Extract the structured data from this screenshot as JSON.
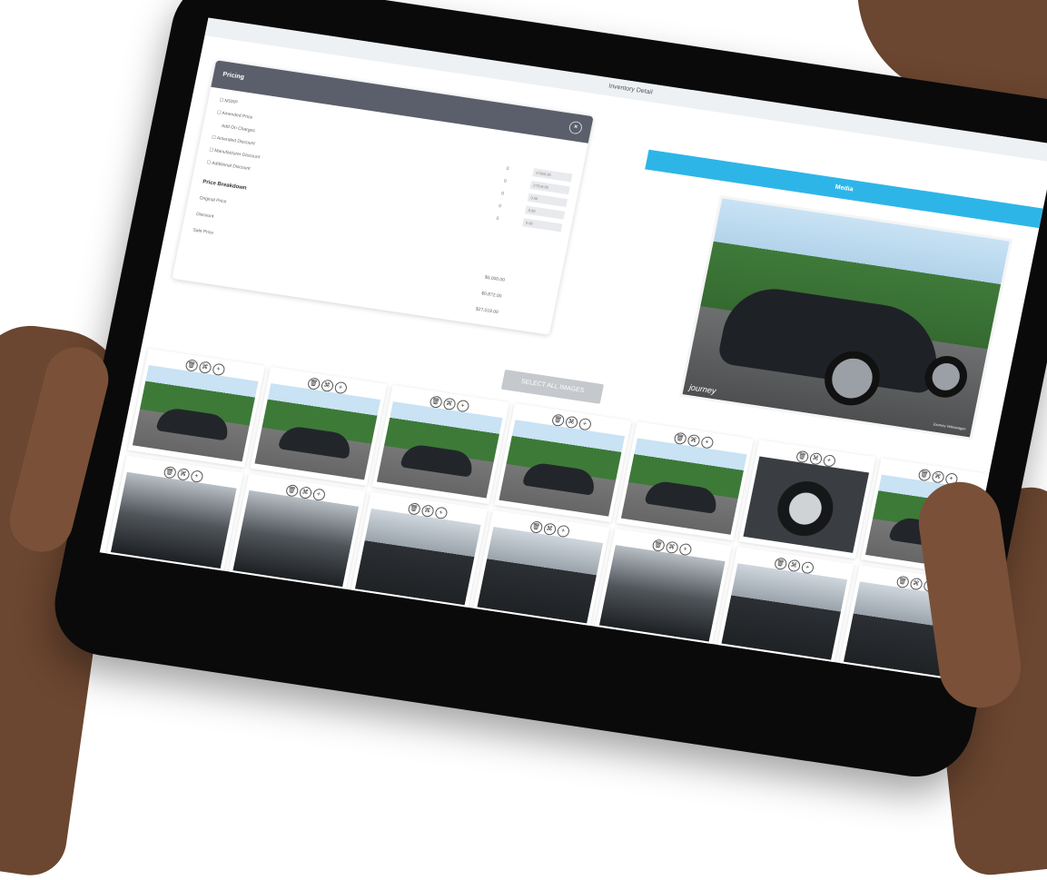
{
  "window": {
    "title": "Inventory Detail"
  },
  "pricing": {
    "header": "Pricing",
    "close_icon": "close-icon",
    "rows": [
      {
        "label": "MSRP",
        "num": "",
        "value": ""
      },
      {
        "label": "Amended Price",
        "num": "0",
        "value": "27850.00"
      },
      {
        "label": "Add On Charges",
        "num": "0",
        "value": "27018.00"
      },
      {
        "label": "Amended Discount",
        "num": "0",
        "value": "0.00"
      },
      {
        "label": "Manufacturer Discount",
        "num": "0",
        "value": "0.00"
      },
      {
        "label": "Additional Discount",
        "num": "0",
        "value": "0.00"
      }
    ],
    "breakdown": {
      "title": "Price Breakdown",
      "items": [
        {
          "label": "Original Price",
          "value": "$0,000.00"
        },
        {
          "label": "Discount",
          "value": "$0,872.00"
        },
        {
          "label": "Sale Price",
          "value": "$27,018.00"
        }
      ]
    }
  },
  "media": {
    "title": "Media",
    "watermark": "journey",
    "dealer_text": "Journey Volkswagen"
  },
  "actions": {
    "select_all": "SELECT ALL IMAGES"
  },
  "thumbnails": {
    "tool_icons": [
      "trash-icon",
      "link-icon",
      "plus-icon"
    ],
    "items": [
      {
        "kind": "car"
      },
      {
        "kind": "car"
      },
      {
        "kind": "car"
      },
      {
        "kind": "car"
      },
      {
        "kind": "car"
      },
      {
        "kind": "wheel"
      },
      {
        "kind": "car"
      },
      {
        "kind": "dark"
      },
      {
        "kind": "dark"
      },
      {
        "kind": "interior"
      },
      {
        "kind": "interior"
      },
      {
        "kind": "dark"
      },
      {
        "kind": "interior"
      },
      {
        "kind": "interior"
      }
    ]
  }
}
